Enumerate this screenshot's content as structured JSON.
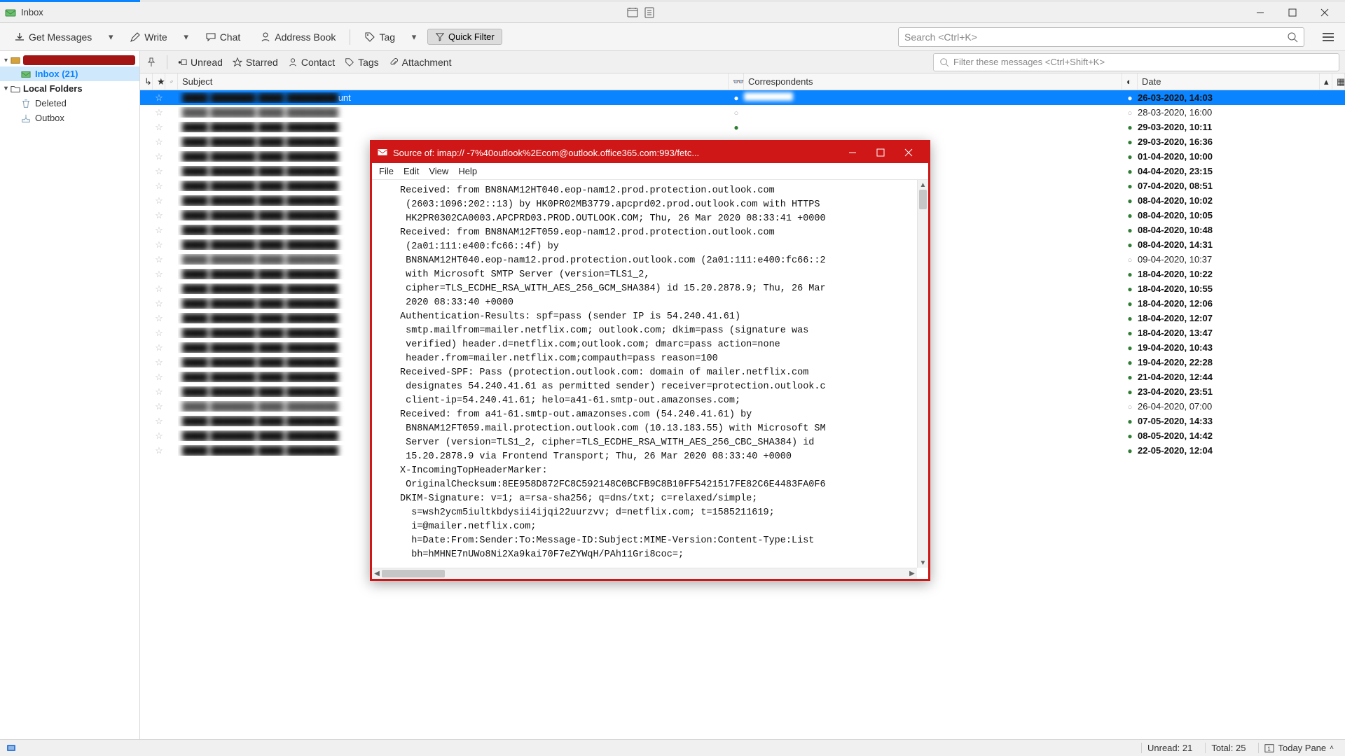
{
  "window": {
    "title": "Inbox"
  },
  "toolbar": {
    "get_messages": "Get Messages",
    "write": "Write",
    "chat": "Chat",
    "address_book": "Address Book",
    "tag": "Tag",
    "quick_filter": "Quick Filter",
    "search_placeholder": "Search <Ctrl+K>"
  },
  "filterbar": {
    "unread": "Unread",
    "starred": "Starred",
    "contact": "Contact",
    "tags": "Tags",
    "attachment": "Attachment",
    "filter_placeholder": "Filter these messages <Ctrl+Shift+K>"
  },
  "sidebar": {
    "inbox_label": "Inbox (21)",
    "local_folders": "Local Folders",
    "deleted": "Deleted",
    "outbox": "Outbox"
  },
  "columns": {
    "subject": "Subject",
    "correspondents": "Correspondents",
    "date": "Date"
  },
  "messages": [
    {
      "unread": true,
      "selected": true,
      "subject_tail": "unt",
      "date": "26-03-2020, 14:03"
    },
    {
      "unread": false,
      "date": "28-03-2020, 16:00"
    },
    {
      "unread": true,
      "date": "29-03-2020, 10:11"
    },
    {
      "unread": true,
      "date": "29-03-2020, 16:36"
    },
    {
      "unread": true,
      "date": "01-04-2020, 10:00"
    },
    {
      "unread": true,
      "date": "04-04-2020, 23:15"
    },
    {
      "unread": true,
      "date": "07-04-2020, 08:51"
    },
    {
      "unread": true,
      "date": "08-04-2020, 10:02"
    },
    {
      "unread": true,
      "date": "08-04-2020, 10:05"
    },
    {
      "unread": true,
      "date": "08-04-2020, 10:48"
    },
    {
      "unread": true,
      "date": "08-04-2020, 14:31"
    },
    {
      "unread": false,
      "date": "09-04-2020, 10:37"
    },
    {
      "unread": true,
      "date": "18-04-2020, 10:22"
    },
    {
      "unread": true,
      "date": "18-04-2020, 10:55"
    },
    {
      "unread": true,
      "date": "18-04-2020, 12:06"
    },
    {
      "unread": true,
      "date": "18-04-2020, 12:07"
    },
    {
      "unread": true,
      "date": "18-04-2020, 13:47"
    },
    {
      "unread": true,
      "date": "19-04-2020, 10:43"
    },
    {
      "unread": true,
      "date": "19-04-2020, 22:28"
    },
    {
      "unread": true,
      "date": "21-04-2020, 12:44"
    },
    {
      "unread": true,
      "date": "23-04-2020, 23:51"
    },
    {
      "unread": false,
      "date": "26-04-2020, 07:00"
    },
    {
      "unread": true,
      "date": "07-05-2020, 14:33"
    },
    {
      "unread": true,
      "date": "08-05-2020, 14:42"
    },
    {
      "unread": true,
      "date": "22-05-2020, 12:04"
    }
  ],
  "statusbar": {
    "unread": "Unread: 21",
    "total": "Total: 25",
    "today_pane": "Today Pane"
  },
  "source_window": {
    "title_prefix": "Source of: imap://",
    "title_suffix": "-7%40outlook%2Ecom@outlook.office365.com:993/fetc...",
    "menu": {
      "file": "File",
      "edit": "Edit",
      "view": "View",
      "help": "Help"
    },
    "body": "Received: from BN8NAM12HT040.eop-nam12.prod.protection.outlook.com\n (2603:1096:202::13) by HK0PR02MB3779.apcprd02.prod.outlook.com with HTTPS\n HK2PR0302CA0003.APCPRD03.PROD.OUTLOOK.COM; Thu, 26 Mar 2020 08:33:41 +0000\nReceived: from BN8NAM12FT059.eop-nam12.prod.protection.outlook.com\n (2a01:111:e400:fc66::4f) by\n BN8NAM12HT040.eop-nam12.prod.protection.outlook.com (2a01:111:e400:fc66::2\n with Microsoft SMTP Server (version=TLS1_2,\n cipher=TLS_ECDHE_RSA_WITH_AES_256_GCM_SHA384) id 15.20.2878.9; Thu, 26 Mar\n 2020 08:33:40 +0000\nAuthentication-Results: spf=pass (sender IP is 54.240.41.61)\n smtp.mailfrom=mailer.netflix.com; outlook.com; dkim=pass (signature was\n verified) header.d=netflix.com;outlook.com; dmarc=pass action=none\n header.from=mailer.netflix.com;compauth=pass reason=100\nReceived-SPF: Pass (protection.outlook.com: domain of mailer.netflix.com\n designates 54.240.41.61 as permitted sender) receiver=protection.outlook.c\n client-ip=54.240.41.61; helo=a41-61.smtp-out.amazonses.com;\nReceived: from a41-61.smtp-out.amazonses.com (54.240.41.61) by\n BN8NAM12FT059.mail.protection.outlook.com (10.13.183.55) with Microsoft SM\n Server (version=TLS1_2, cipher=TLS_ECDHE_RSA_WITH_AES_256_CBC_SHA384) id\n 15.20.2878.9 via Frontend Transport; Thu, 26 Mar 2020 08:33:40 +0000\nX-IncomingTopHeaderMarker:\n OriginalChecksum:8EE958D872FC8C592148C0BCFB9C8B10FF5421517FE82C6E4483FA0F6\nDKIM-Signature: v=1; a=rsa-sha256; q=dns/txt; c=relaxed/simple;\n  s=wsh2ycm5iultkbdysii4ijqi22uurzvv; d=netflix.com; t=1585211619;\n  i=@mailer.netflix.com;\n  h=Date:From:Sender:To:Message-ID:Subject:MIME-Version:Content-Type:List\n  bh=hMHNE7nUWo8Ni2Xa9kai70F7eZYWqH/PAh11Gri8coc=;"
  }
}
